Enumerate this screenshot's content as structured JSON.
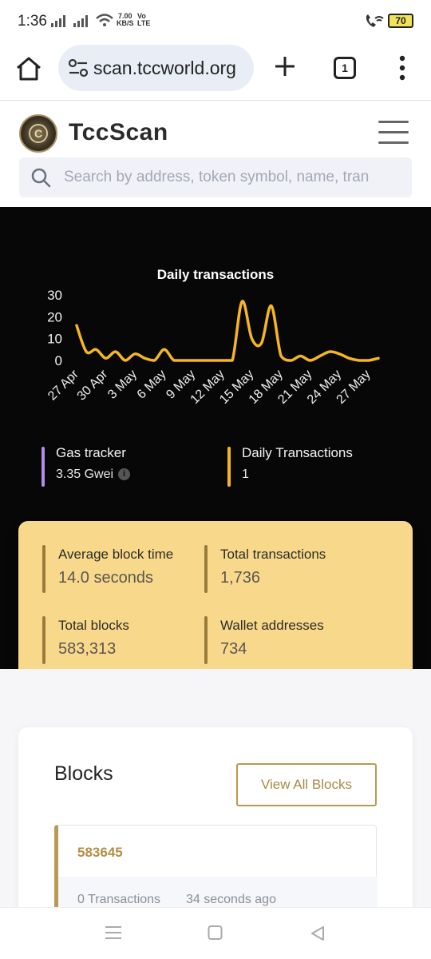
{
  "status_bar": {
    "time": "1:36",
    "speed_value": "7.00",
    "speed_unit": "KB/S",
    "volte_top": "Vo",
    "volte_bottom": "LTE",
    "battery": "70"
  },
  "browser": {
    "url": "scan.tccworld.org",
    "tab_count": "1"
  },
  "site": {
    "brand": "TccScan",
    "logo_letter": "C",
    "search_placeholder": "Search by address, token symbol, name, tran"
  },
  "chart_data": {
    "type": "line",
    "title": "Daily transactions",
    "x": [
      "27 Apr",
      "28 Apr",
      "29 Apr",
      "30 Apr",
      "1 May",
      "2 May",
      "3 May",
      "4 May",
      "5 May",
      "6 May",
      "7 May",
      "8 May",
      "9 May",
      "10 May",
      "11 May",
      "12 May",
      "13 May",
      "14 May",
      "15 May",
      "16 May",
      "17 May",
      "18 May",
      "19 May",
      "20 May",
      "21 May",
      "22 May",
      "23 May",
      "24 May",
      "25 May",
      "26 May",
      "27 May",
      "28 May"
    ],
    "x_tick_labels": [
      "27 Apr",
      "30 Apr",
      "3 May",
      "6 May",
      "9 May",
      "12 May",
      "15 May",
      "18 May",
      "21 May",
      "24 May",
      "27 May"
    ],
    "series": [
      {
        "values": [
          16,
          4,
          5,
          1,
          4,
          0,
          3,
          1,
          0,
          5,
          0,
          0,
          0,
          0,
          0,
          0,
          0,
          27,
          10,
          8,
          25,
          2,
          0,
          2,
          0,
          2,
          4,
          3,
          1,
          0,
          0,
          1
        ],
        "color": "#f5b621"
      }
    ],
    "y_ticks": [
      0,
      10,
      20,
      30
    ],
    "ylim": [
      0,
      30
    ],
    "grid": false
  },
  "tickers": {
    "gas_label": "Gas tracker",
    "gas_value": "3.35 Gwei",
    "gas_color": "#b08ee6",
    "daily_label": "Daily Transactions",
    "daily_value": "1",
    "daily_color": "#f5b621"
  },
  "stats": {
    "avg_block_time_label": "Average block time",
    "avg_block_time_value": "14.0 seconds",
    "total_tx_label": "Total transactions",
    "total_tx_value": "1,736",
    "total_blocks_label": "Total blocks",
    "total_blocks_value": "583,313",
    "wallets_label": "Wallet addresses",
    "wallets_value": "734"
  },
  "blocks": {
    "title": "Blocks",
    "view_all_label": "View All Blocks",
    "items": [
      {
        "number": "583645",
        "transactions": "0 Transactions",
        "age": "34 seconds ago"
      }
    ]
  }
}
